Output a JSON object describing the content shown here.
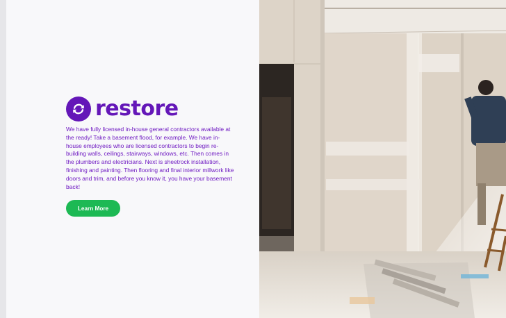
{
  "brand": {
    "name": "restore",
    "accent_color": "#6417b8",
    "icon": "refresh-arrows-icon"
  },
  "hero": {
    "body": "We have fully licensed in-house general contractors available at the ready! Take a basement flood, for example. We have in-house employees who are licensed contractors to begin re-building walls, ceilings, stairways, windows, etc. Then comes in the plumbers and electricians. Next is sheetrock installation, finishing and painting. Then flooring and final interior millwork like doors and trim, and before you know it, you have your basement back!",
    "cta_label": "Learn More",
    "cta_color": "#1db954"
  }
}
